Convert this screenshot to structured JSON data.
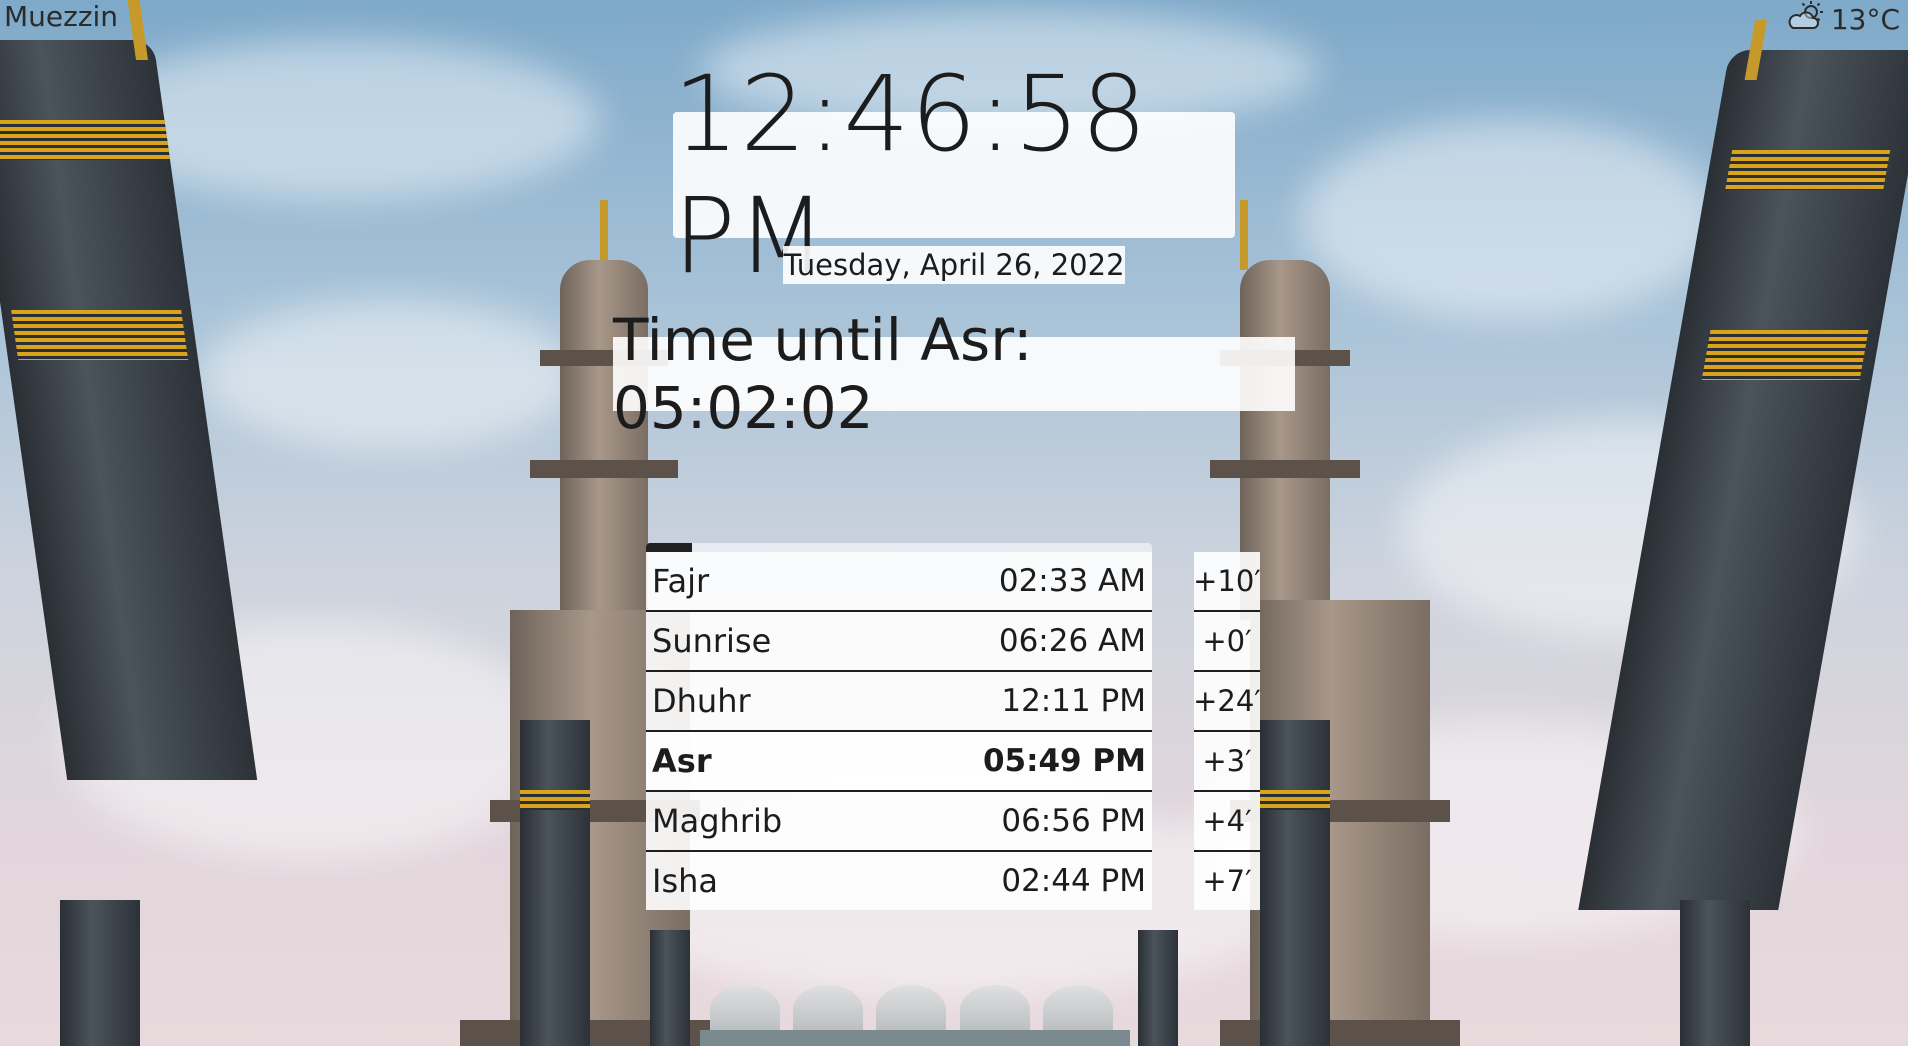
{
  "app": {
    "title": "Muezzin"
  },
  "weather": {
    "icon": "partly-cloudy-sun-icon",
    "temperature": "13°C"
  },
  "clock": {
    "time": "12:46:58 PM",
    "date": "Tuesday, April 26, 2022"
  },
  "countdown": {
    "text": "Time until Asr: 05:02:02"
  },
  "progress": {
    "fraction": 0.09
  },
  "prayers": [
    {
      "name": "Fajr",
      "time": "02:33 AM",
      "offset": "+10′",
      "current": false
    },
    {
      "name": "Sunrise",
      "time": "06:26 AM",
      "offset": "+0′",
      "current": false
    },
    {
      "name": "Dhuhr",
      "time": "12:11 PM",
      "offset": "+24′",
      "current": false
    },
    {
      "name": "Asr",
      "time": "05:49 PM",
      "offset": "+3′",
      "current": true
    },
    {
      "name": "Maghrib",
      "time": "06:56 PM",
      "offset": "+4′",
      "current": false
    },
    {
      "name": "Isha",
      "time": "02:44 PM",
      "offset": "+7′",
      "current": false
    }
  ]
}
